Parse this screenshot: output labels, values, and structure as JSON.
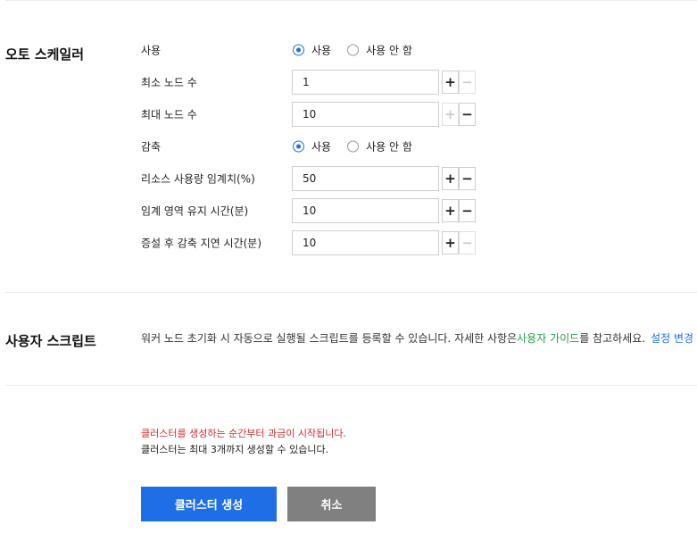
{
  "autoscaler": {
    "title": "오토 스케일러",
    "use": {
      "label": "사용",
      "options": [
        "사용",
        "사용 안 함"
      ],
      "selected": 0
    },
    "min_nodes": {
      "label": "최소 노드 수",
      "value": "1"
    },
    "max_nodes": {
      "label": "최대 노드 수",
      "value": "10"
    },
    "scale_down": {
      "label": "감축",
      "options": [
        "사용",
        "사용 안 함"
      ],
      "selected": 0
    },
    "threshold": {
      "label": "리소스 사용량 임계치(%)",
      "value": "50"
    },
    "threshold_duration": {
      "label": "임계 영역 유지 시간(분)",
      "value": "10"
    },
    "scale_down_delay": {
      "label": "증설 후 감축 지연 시간(분)",
      "value": "10"
    }
  },
  "user_script": {
    "title": "사용자 스크립트",
    "desc_before": "워커 노드 초기화 시 자동으로 실행될 스크립트를 등록할 수 있습니다. 자세한 사항은 ",
    "guide_link": "사용자 가이드",
    "desc_after": "를 참고하세요.",
    "settings_label": "설정 변경"
  },
  "notices": {
    "billing": "클러스터를 생성하는 순간부터 과금이 시작됩니다.",
    "limit": "클러스터는 최대 3개까지 생성할 수 있습니다."
  },
  "buttons": {
    "create": "클러스터 생성",
    "cancel": "취소"
  },
  "colors": {
    "accent": "#1e6fe6",
    "link_green": "#23a148",
    "warning_red": "#d42d2d",
    "cancel_gray": "#808080"
  }
}
